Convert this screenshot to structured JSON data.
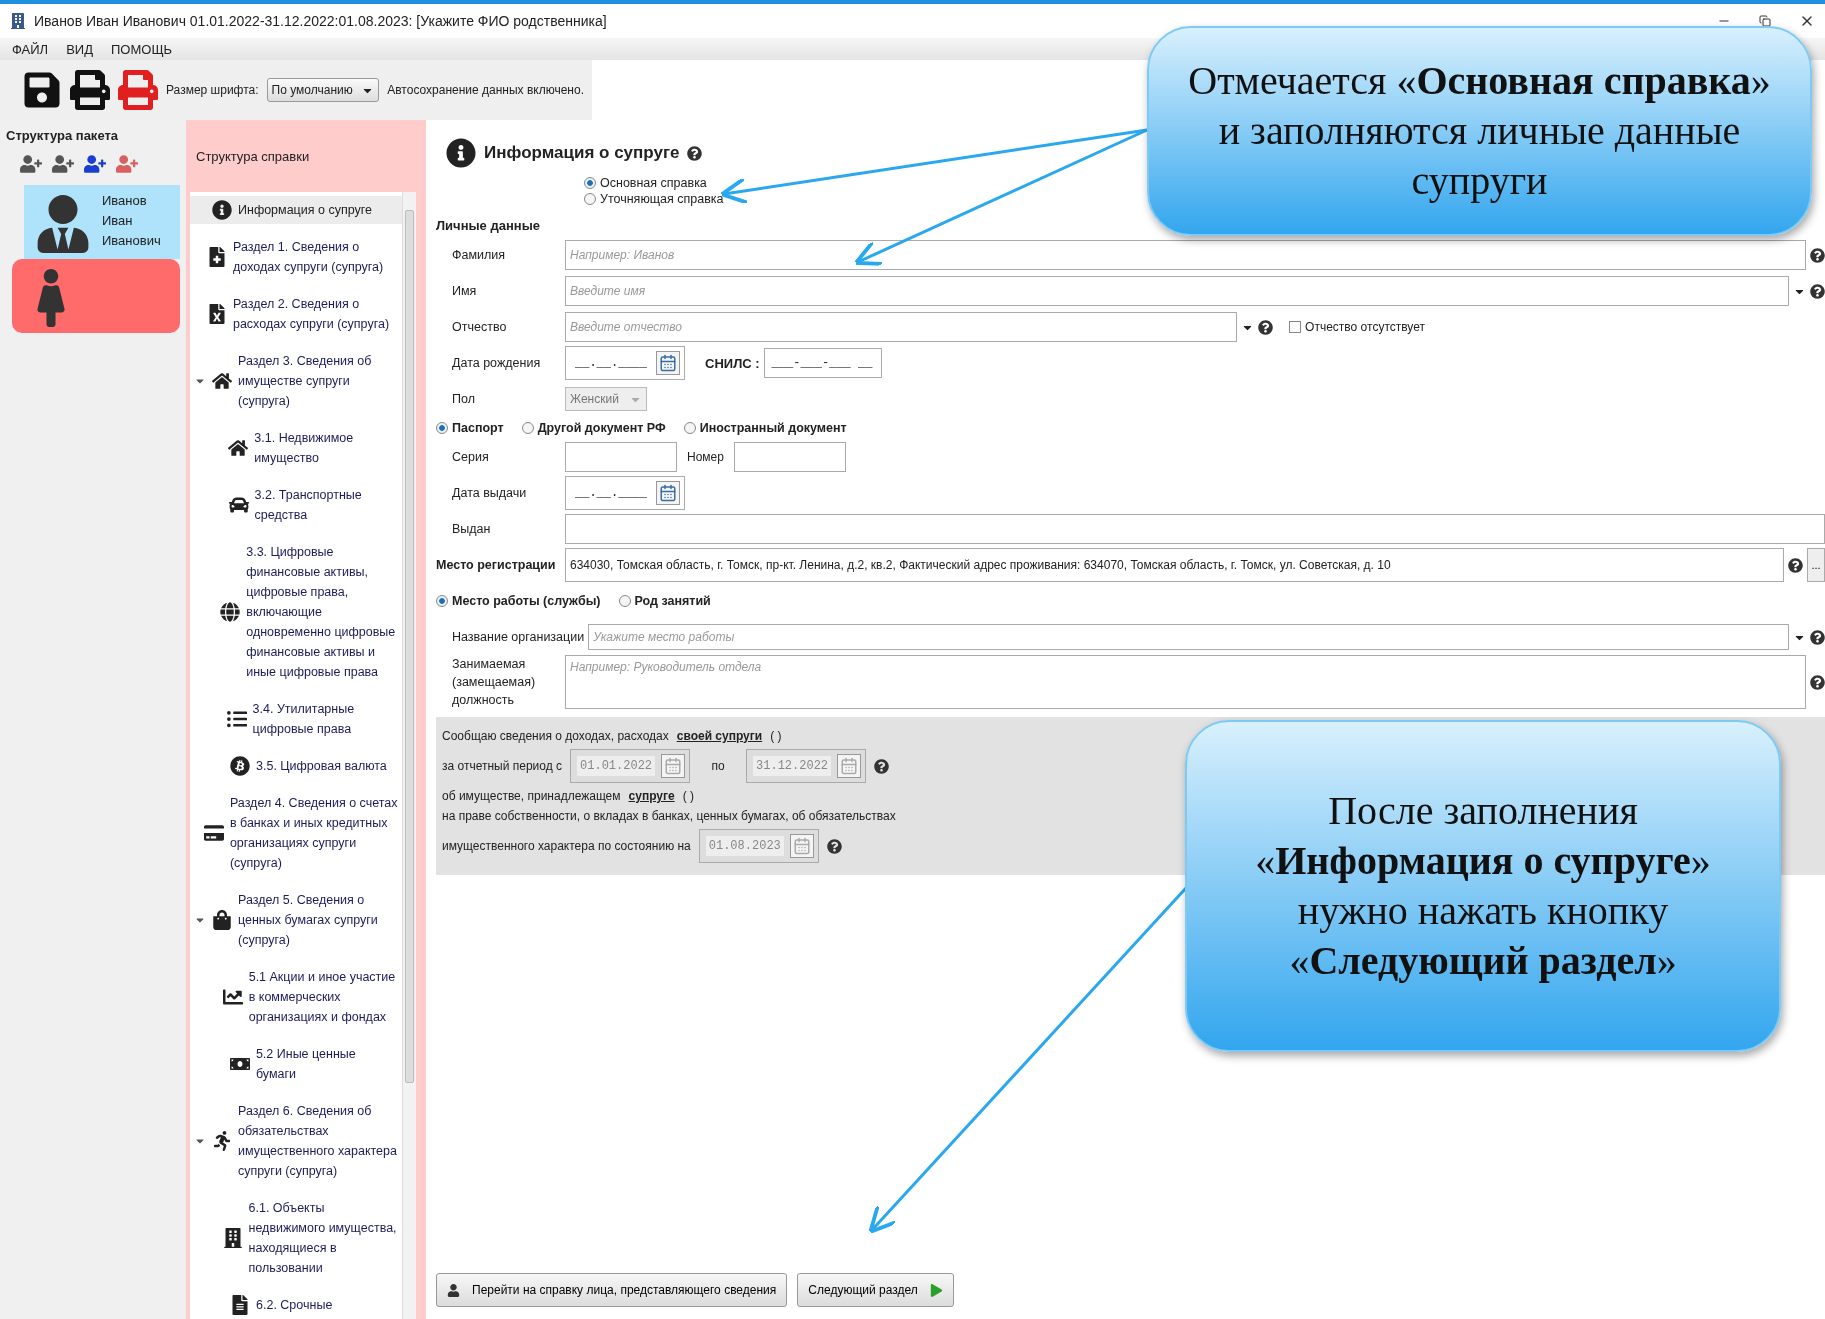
{
  "window": {
    "title": "Иванов Иван Иванович 01.01.2022-31.12.2022:01.08.2023: [Укажите ФИО родственника]"
  },
  "menu": [
    "ФАЙЛ",
    "ВИД",
    "ПОМОЩЬ"
  ],
  "toolbar": {
    "font_label": "Размер шрифта:",
    "font_value": "По умолчанию",
    "autosave": "Автосохранение данных включено."
  },
  "package": {
    "title": "Структура пакета",
    "people": [
      {
        "kind": "male",
        "name": "Иванов Иван Иванович",
        "color": "#aee3fb"
      },
      {
        "kind": "female",
        "color": "#ff6b6b"
      }
    ]
  },
  "tree": {
    "title": "Структура справки",
    "items": [
      {
        "kind": "info",
        "label": "Информация о супруге",
        "selected": true
      },
      {
        "kind": "income",
        "label": "Раздел 1. Сведения о доходах супруги (супруга)",
        "selected": false
      },
      {
        "kind": "expense",
        "label": "Раздел 2. Сведения о расходах супруги (супруга)",
        "selected": false
      },
      {
        "kind": "property",
        "label": "Раздел 3. Сведения об имуществе супруги (супруга)",
        "selected": false,
        "expanded": true,
        "children": [
          {
            "kind": "house",
            "label": "3.1. Недвижимое имущество",
            "selected": false
          },
          {
            "kind": "car",
            "label": "3.2. Транспортные средства",
            "selected": false
          },
          {
            "kind": "globe",
            "label": "3.3. Цифровые финансовые активы, цифровые права, включающие одновременно цифровые финансовые активы и иные цифровые права",
            "selected": false
          },
          {
            "kind": "list",
            "label": "3.4. Утилитарные цифровые права",
            "selected": false
          },
          {
            "kind": "bitcoin",
            "label": "3.5. Цифровая валюта",
            "selected": false
          }
        ]
      },
      {
        "kind": "card",
        "label": "Раздел 4. Сведения о счетах в банках и иных кредитных организациях супруги (супруга)",
        "selected": false
      },
      {
        "kind": "bag",
        "label": "Раздел 5. Сведения о ценных бумагах супруги (супруга)",
        "selected": false,
        "expanded": true,
        "children": [
          {
            "kind": "chart",
            "label": "5.1 Акции и иное участие в коммерческих организациях и фондах",
            "selected": false
          },
          {
            "kind": "banknote",
            "label": "5.2 Иные ценные бумаги",
            "selected": false
          }
        ]
      },
      {
        "kind": "runner",
        "label": "Раздел 6. Сведения об обязательствах имущественного характера супруги (супруга)",
        "selected": false,
        "expanded": true,
        "children": [
          {
            "kind": "building",
            "label": "6.1. Объекты недвижимого имущества, находящиеся в пользовании",
            "selected": false
          },
          {
            "kind": "doc",
            "label": "6.2. Срочные",
            "selected": false
          }
        ]
      }
    ]
  },
  "form": {
    "title": "Информация о супруге",
    "report_type": [
      {
        "label": "Основная справка",
        "selected": true
      },
      {
        "label": "Уточняющая справка",
        "selected": false
      }
    ],
    "personal_title": "Личные данные",
    "surname": {
      "label": "Фамилия",
      "placeholder": "Например:  Иванов"
    },
    "name": {
      "label": "Имя",
      "placeholder": "Введите имя"
    },
    "patronymic": {
      "label": "Отчество",
      "placeholder": "Введите отчество",
      "absent": {
        "label": "Отчество отсутствует",
        "checked": false
      }
    },
    "birth_date": {
      "label": "Дата рождения",
      "mask": "__.__.____"
    },
    "snils": {
      "label": "СНИЛС :",
      "mask": "___-___-___ __"
    },
    "gender": {
      "label": "Пол",
      "value": "Женский"
    },
    "document_types": [
      {
        "label": "Паспорт",
        "selected": true
      },
      {
        "label": "Другой документ РФ",
        "selected": false
      },
      {
        "label": "Иностранный документ",
        "selected": false
      }
    ],
    "series": {
      "label": "Серия"
    },
    "number": {
      "label": "Номер"
    },
    "issue_date": {
      "label": "Дата выдачи",
      "mask": "__.__.____"
    },
    "issued_by": {
      "label": "Выдан"
    },
    "registration": {
      "label": "Место регистрации",
      "value": "634030, Томская область, г. Томск, пр-кт. Ленина, д.2, кв.2, Фактический адрес проживания: 634070, Томская область, г. Томск, ул. Советская, д. 10",
      "button": "..."
    },
    "work_types": [
      {
        "label": "Место работы (службы)",
        "selected": true
      },
      {
        "label": "Род занятий",
        "selected": false
      }
    ],
    "organization": {
      "label": "Название организации",
      "placeholder": "Укажите место работы"
    },
    "position": {
      "label": "Занимаемая (замещаемая) должность",
      "placeholder": "Например:  Руководитель отдела"
    },
    "statement": {
      "line1": "Сообщаю сведения о доходах, расходах",
      "link1": "своей супруги",
      "paren1": "( )",
      "period_label": "за отчетный период с",
      "from": "01.01.2022",
      "to_label": "по",
      "to": "31.12.2022",
      "line2": "об имуществе, принадлежащем",
      "link2": "супруге",
      "paren2": "( )",
      "line3": " на праве собственности, о вкладах в банках, ценных бумагах, об обязательствах",
      "line4": "имущественного характера по состоянию на",
      "date": "01.08.2023"
    },
    "buttons": {
      "back": "Перейти на справку лица, представляющего сведения",
      "next": "Следующий раздел"
    }
  },
  "callouts": [
    {
      "text": "Отмечается «**Основная справка**» и заполняются личные данные супруги"
    },
    {
      "text": "После заполнения «**Информация о супруге**» нужно нажать кнопку «**Следующий раздел**»"
    }
  ]
}
